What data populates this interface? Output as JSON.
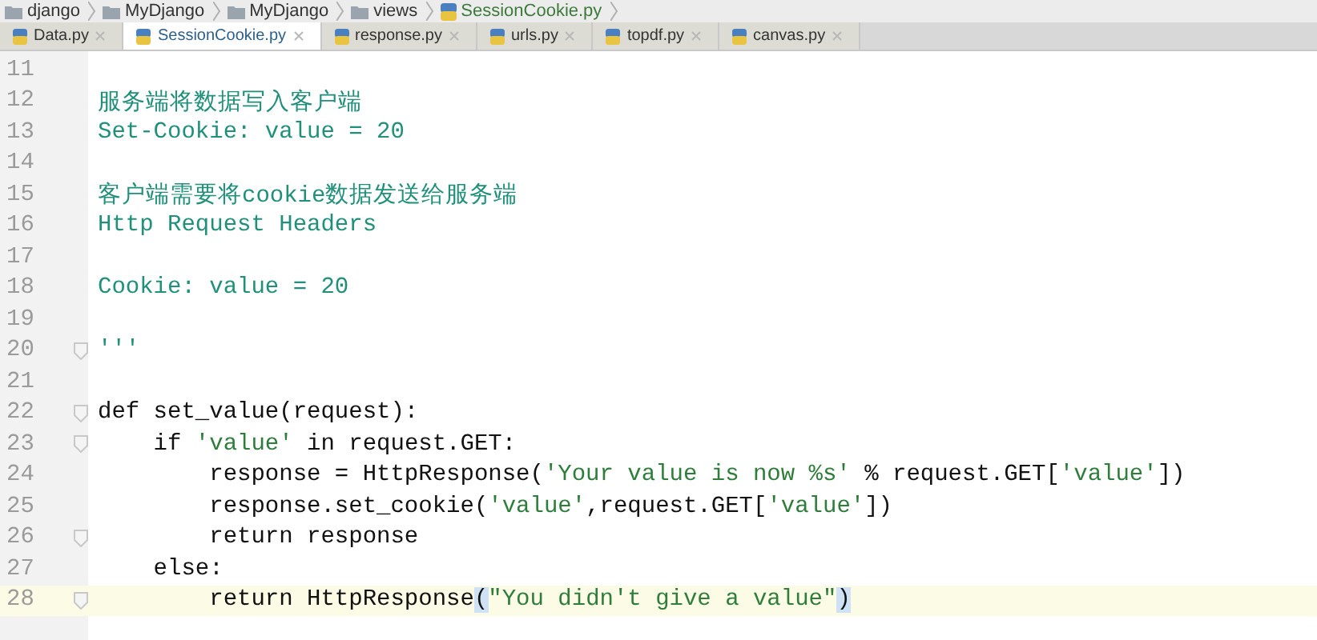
{
  "breadcrumbs": [
    {
      "label": "django",
      "kind": "folder"
    },
    {
      "label": "MyDjango",
      "kind": "folder"
    },
    {
      "label": "MyDjango",
      "kind": "folder"
    },
    {
      "label": "views",
      "kind": "folder"
    },
    {
      "label": "SessionCookie.py",
      "kind": "file"
    }
  ],
  "tabs": [
    {
      "label": "Data.py",
      "selected": false
    },
    {
      "label": "SessionCookie.py",
      "selected": true
    },
    {
      "label": "response.py",
      "selected": false
    },
    {
      "label": "urls.py",
      "selected": false
    },
    {
      "label": "topdf.py",
      "selected": false
    },
    {
      "label": "canvas.py",
      "selected": false
    }
  ],
  "lines": [
    {
      "number": "11",
      "current": false,
      "fold_marker": false
    },
    {
      "number": "12",
      "current": false,
      "fold_marker": false,
      "segments": [
        {
          "text": "服务端将数据写入客户端",
          "kind": "docstring"
        }
      ]
    },
    {
      "number": "13",
      "current": false,
      "fold_marker": false,
      "segments": [
        {
          "text": "Set-Cookie: value = 20",
          "kind": "docstring"
        }
      ]
    },
    {
      "number": "14",
      "current": false,
      "fold_marker": false
    },
    {
      "number": "15",
      "current": false,
      "fold_marker": false,
      "segments": [
        {
          "text": "客户端需要将cookie数据发送给服务端",
          "kind": "docstring"
        }
      ]
    },
    {
      "number": "16",
      "current": false,
      "fold_marker": false,
      "segments": [
        {
          "text": "Http Request Headers",
          "kind": "docstring"
        }
      ]
    },
    {
      "number": "17",
      "current": false,
      "fold_marker": false
    },
    {
      "number": "18",
      "current": false,
      "fold_marker": false,
      "segments": [
        {
          "text": "Cookie: value = 20",
          "kind": "docstring"
        }
      ]
    },
    {
      "number": "19",
      "current": false,
      "fold_marker": false
    },
    {
      "number": "20",
      "current": false,
      "fold_marker": true,
      "segments": [
        {
          "text": "'''",
          "kind": "docstring"
        }
      ]
    },
    {
      "number": "21",
      "current": false,
      "fold_marker": false
    },
    {
      "number": "22",
      "current": false,
      "fold_marker": true,
      "segments": [
        {
          "text": "def set_value(request):",
          "kind": "code"
        }
      ]
    },
    {
      "number": "23",
      "current": false,
      "fold_marker": true,
      "segments": [
        {
          "text": "    if ",
          "kind": "code"
        },
        {
          "text": "'value'",
          "kind": "string"
        },
        {
          "text": " in request.GET:",
          "kind": "code"
        }
      ]
    },
    {
      "number": "24",
      "current": false,
      "fold_marker": false,
      "segments": [
        {
          "text": "        response = HttpResponse(",
          "kind": "code"
        },
        {
          "text": "'Your value is now %s'",
          "kind": "string"
        },
        {
          "text": " % request.GET[",
          "kind": "code"
        },
        {
          "text": "'value'",
          "kind": "string"
        },
        {
          "text": "])",
          "kind": "code"
        }
      ]
    },
    {
      "number": "25",
      "current": false,
      "fold_marker": false,
      "segments": [
        {
          "text": "        response.set_cookie(",
          "kind": "code"
        },
        {
          "text": "'value'",
          "kind": "string"
        },
        {
          "text": ",request.GET[",
          "kind": "code"
        },
        {
          "text": "'value'",
          "kind": "string"
        },
        {
          "text": "])",
          "kind": "code"
        }
      ]
    },
    {
      "number": "26",
      "current": false,
      "fold_marker": true,
      "segments": [
        {
          "text": "        return response",
          "kind": "code"
        }
      ]
    },
    {
      "number": "27",
      "current": false,
      "fold_marker": false,
      "segments": [
        {
          "text": "    else:",
          "kind": "code"
        }
      ]
    },
    {
      "number": "28",
      "current": true,
      "fold_marker": true,
      "segments": [
        {
          "text": "        return HttpResponse",
          "kind": "code"
        },
        {
          "text": "(",
          "kind": "bracket"
        },
        {
          "text": "\"You didn't give a value\"",
          "kind": "string"
        },
        {
          "text": ")",
          "kind": "bracket"
        }
      ]
    }
  ]
}
